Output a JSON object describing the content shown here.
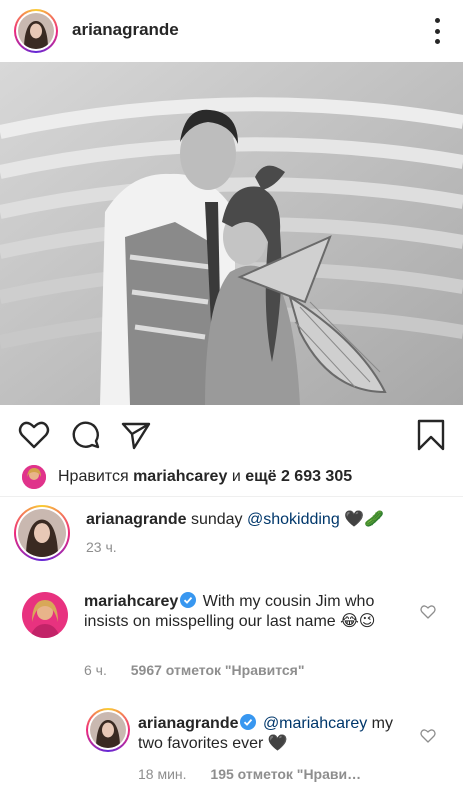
{
  "header": {
    "username": "arianagrande",
    "more_icon": "more-vertical-icon"
  },
  "actions": {
    "like_icon": "heart-icon",
    "comment_icon": "comment-icon",
    "share_icon": "send-icon",
    "save_icon": "bookmark-icon"
  },
  "likes": {
    "prefix": "Нравится",
    "user": "mariahcarey",
    "conjunction": "и",
    "others": "ещё 2 693 305"
  },
  "caption": {
    "username": "arianagrande",
    "text_before": "sunday",
    "mention": "@shokidding",
    "emoji": "🖤🥒",
    "time": "23 ч."
  },
  "comments": [
    {
      "username": "mariahcarey",
      "verified": true,
      "text": "With my cousin Jim who insists on misspelling our last name 😂😉",
      "time": "6 ч.",
      "likes": "5967 отметок \"Нравится\""
    },
    {
      "username": "arianagrande",
      "verified": true,
      "mention": "@mariahcarey",
      "text": "my two favorites ever 🖤",
      "time": "18 мин.",
      "likes": "195 отметок \"Нрави…"
    }
  ],
  "colors": {
    "text": "#262626",
    "muted": "#8e8e8e",
    "mention": "#00376b",
    "verified": "#3897f0"
  }
}
